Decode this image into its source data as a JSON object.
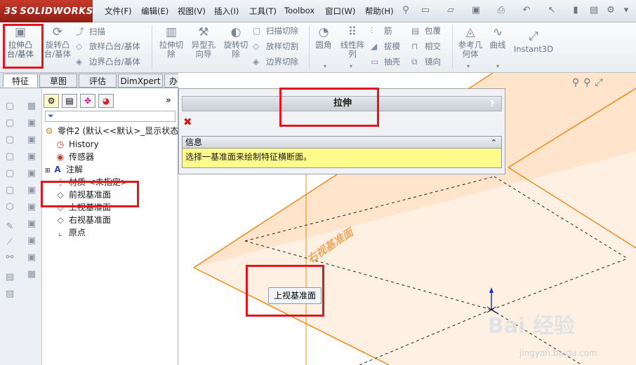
{
  "app": {
    "logo_prefix": "3S",
    "logo_name": "SOLIDWORKS"
  },
  "menu": [
    {
      "label": "文件(F)"
    },
    {
      "label": "编辑(E)"
    },
    {
      "label": "视图(V)"
    },
    {
      "label": "插入(I)"
    },
    {
      "label": "工具(T)"
    },
    {
      "label": "Toolbox"
    },
    {
      "label": "窗口(W)"
    },
    {
      "label": "帮助(H)"
    }
  ],
  "ribbon": {
    "extrude_boss": "拉伸凸\n台/基体",
    "revolve_boss": "旋转凸\n台/基体",
    "sweep": "扫描",
    "loft_boss": "放样凸台/基体",
    "boundary_boss": "边界凸台/基体",
    "extrude_cut": "拉伸切\n除",
    "hole_wizard": "异型孔\n向导",
    "revolve_cut": "旋转切\n除",
    "swept_cut": "扫描切除",
    "lofted_cut": "放样切割",
    "boundary_cut": "边界切除",
    "fillet": "圆角",
    "linear_pattern": "线性阵\n列",
    "rib": "筋",
    "draft": "拔模",
    "shell": "抽壳",
    "wrap": "包覆",
    "intersect": "相交",
    "mirror": "镜向",
    "ref_geometry": "参考几\n何体",
    "curves": "曲线",
    "instant3d": "Instant3D"
  },
  "tabs": [
    {
      "label": "特征"
    },
    {
      "label": "草图"
    },
    {
      "label": "评估"
    },
    {
      "label": "DimXpert"
    },
    {
      "label": "办公室产品"
    }
  ],
  "tree": {
    "root": "零件2 (默认<<默认>_显示状态",
    "items": [
      {
        "label": "History"
      },
      {
        "label": "传感器"
      },
      {
        "label": "注解"
      },
      {
        "label": "材质 <未指定>"
      },
      {
        "label": "前视基准面"
      },
      {
        "label": "上视基准面"
      },
      {
        "label": "右视基准面"
      },
      {
        "label": "原点"
      }
    ]
  },
  "property_manager": {
    "title": "拉伸",
    "help": "?",
    "info_header": "信息",
    "info_text": "选择一基准面来绘制特征横断面。"
  },
  "graphics": {
    "plane_tag": "上视基准面",
    "plane_label_diag": "右视基准面"
  },
  "watermark": {
    "brand": "Bai 经验",
    "url": "jingyan.baidu.com"
  },
  "colors": {
    "accent_red": "#e0171f",
    "plane_orange": "#f08c1e",
    "info_yellow": "#fffb8a"
  }
}
